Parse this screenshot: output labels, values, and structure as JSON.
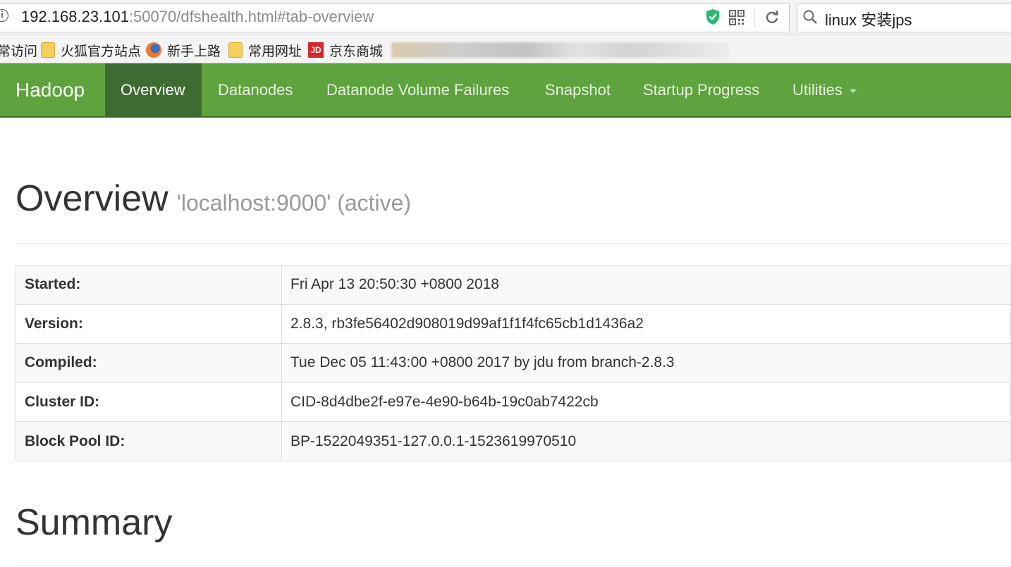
{
  "browser": {
    "url_host": "192.168.23.101",
    "url_rest": ":50070/dfshealth.html#tab-overview",
    "search_text": "linux 安装jps",
    "icons": [
      "info-icon",
      "shield-icon",
      "qr-code-icon",
      "reload-icon",
      "search-icon"
    ]
  },
  "bookmarks": [
    {
      "label": "常访问",
      "icon": ""
    },
    {
      "label": "火狐官方站点",
      "icon": "folder-icon"
    },
    {
      "label": "新手上路",
      "icon": "firefox-icon"
    },
    {
      "label": "常用网址",
      "icon": "folder-icon"
    },
    {
      "label": "京东商城",
      "icon": "jd-icon",
      "icon_text": "JD"
    }
  ],
  "navbar": {
    "brand": "Hadoop",
    "items": [
      {
        "label": "Overview",
        "active": true
      },
      {
        "label": "Datanodes"
      },
      {
        "label": "Datanode Volume Failures"
      },
      {
        "label": "Snapshot"
      },
      {
        "label": "Startup Progress"
      },
      {
        "label": "Utilities",
        "dropdown": true
      }
    ],
    "colors": {
      "bar": "#5fa33e",
      "active": "#3e6b32"
    }
  },
  "overview": {
    "title": "Overview",
    "subtitle": "'localhost:9000' (active)",
    "rows": [
      {
        "key": "Started:",
        "value": "Fri Apr 13 20:50:30 +0800 2018"
      },
      {
        "key": "Version:",
        "value": "2.8.3, rb3fe56402d908019d99af1f1f4fc65cb1d1436a2"
      },
      {
        "key": "Compiled:",
        "value": "Tue Dec 05 11:43:00 +0800 2017 by jdu from branch-2.8.3"
      },
      {
        "key": "Cluster ID:",
        "value": "CID-8d4dbe2f-e97e-4e90-b64b-19c0ab7422cb"
      },
      {
        "key": "Block Pool ID:",
        "value": "BP-1522049351-127.0.0.1-1523619970510"
      }
    ]
  },
  "summary": {
    "title": "Summary"
  }
}
